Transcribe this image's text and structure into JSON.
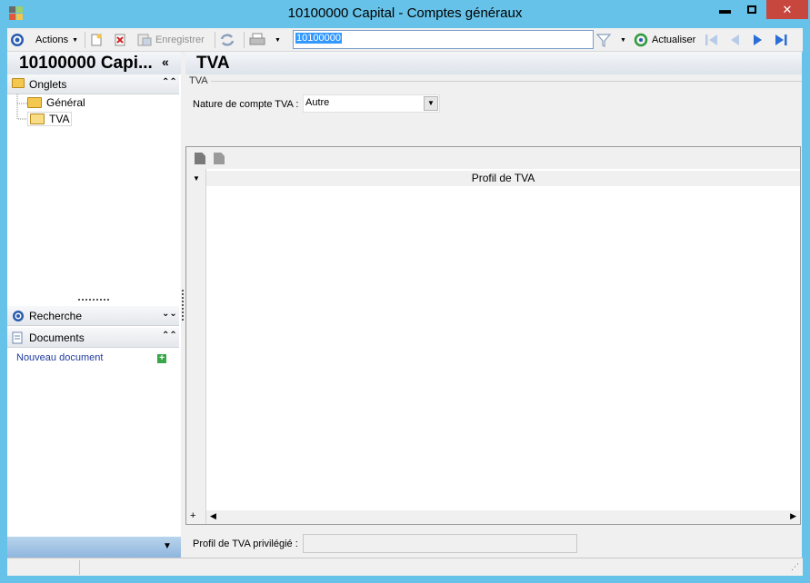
{
  "window": {
    "title": "10100000 Capital -  Comptes généraux"
  },
  "toolbar": {
    "actions_label": "Actions",
    "save_label": "Enregistrer",
    "search_value": "10100000",
    "refresh_label": "Actualiser"
  },
  "left_panel": {
    "title": "10100000 Capi...",
    "collapse_glyph": "«",
    "tabs_section_label": "Onglets",
    "tree_items": [
      {
        "label": "Général"
      },
      {
        "label": "TVA"
      }
    ],
    "search_section_label": "Recherche",
    "documents_section_label": "Documents",
    "new_document_label": "Nouveau document"
  },
  "main": {
    "title": "TVA",
    "group_label": "TVA",
    "vat_nature_label": "Nature de compte TVA :",
    "vat_nature_value": "Autre",
    "grid_column_header": "Profil de TVA",
    "preferred_profile_label": "Profil de TVA privilégié :",
    "preferred_profile_value": ""
  },
  "colors": {
    "titlebar": "#66c2e8",
    "close_button": "#c7463e",
    "selection": "#3399ff"
  }
}
